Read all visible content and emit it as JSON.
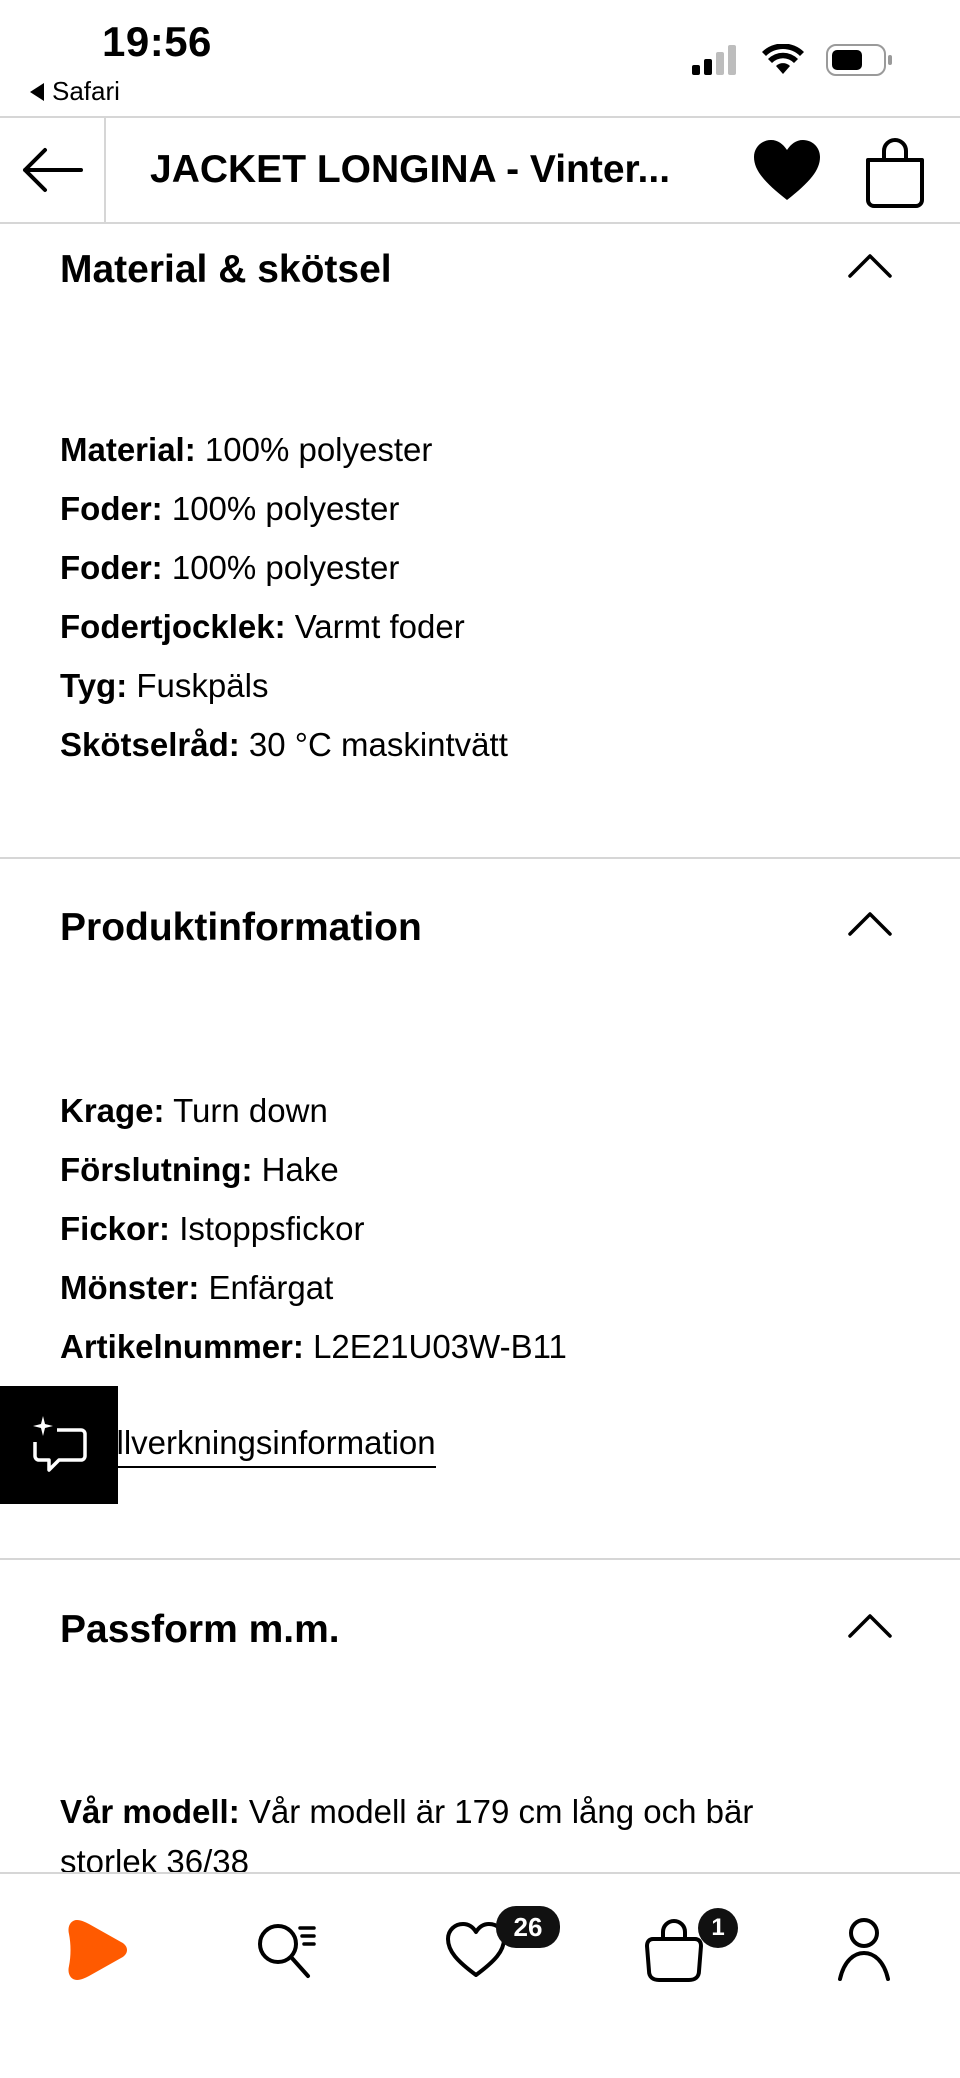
{
  "status_bar": {
    "time": "19:56",
    "back_app": "Safari",
    "icons": [
      "cellular-signal-icon",
      "wifi-icon",
      "battery-icon"
    ]
  },
  "header": {
    "title": "JACKET LONGINA - Vinter...",
    "icons": [
      "arrow-left-icon",
      "heart-filled-icon",
      "shopping-bag-icon"
    ]
  },
  "sections": {
    "material": {
      "title": "Material & skötsel",
      "rows": [
        {
          "label": "Material:",
          "value": "100% polyester"
        },
        {
          "label": "Foder:",
          "value": "100% polyester"
        },
        {
          "label": "Foder:",
          "value": "100% polyester"
        },
        {
          "label": "Fodertjocklek:",
          "value": "Varmt foder"
        },
        {
          "label": "Tyg:",
          "value": "Fuskpäls"
        },
        {
          "label": "Skötselråd:",
          "value": "30 °C maskintvätt"
        }
      ]
    },
    "product": {
      "title": "Produktinformation",
      "rows": [
        {
          "label": "Krage:",
          "value": "Turn down"
        },
        {
          "label": "Förslutning:",
          "value": "Hake"
        },
        {
          "label": "Fickor:",
          "value": "Istoppsfickor"
        },
        {
          "label": "Mönster:",
          "value": "Enfärgat"
        },
        {
          "label": "Artikelnummer:",
          "value": "L2E21U03W-B11"
        }
      ],
      "link": "tillverkningsinformation"
    },
    "fit": {
      "title": "Passform m.m.",
      "rows": [
        {
          "label": "Vår modell:",
          "value": "Vår modell är 179 cm lång och bär"
        },
        {
          "label": "",
          "value": "storlek 36/38"
        }
      ]
    }
  },
  "tabbar": {
    "items": [
      {
        "name": "home",
        "icon": "zalando-logo-icon"
      },
      {
        "name": "search",
        "icon": "search-list-icon"
      },
      {
        "name": "wishlist",
        "icon": "heart-icon",
        "badge": "26"
      },
      {
        "name": "cart",
        "icon": "bag-icon",
        "badge": "1"
      },
      {
        "name": "profile",
        "icon": "user-icon"
      }
    ]
  },
  "colors": {
    "accent": "#ff6900",
    "divider": "#d6d6d6"
  }
}
